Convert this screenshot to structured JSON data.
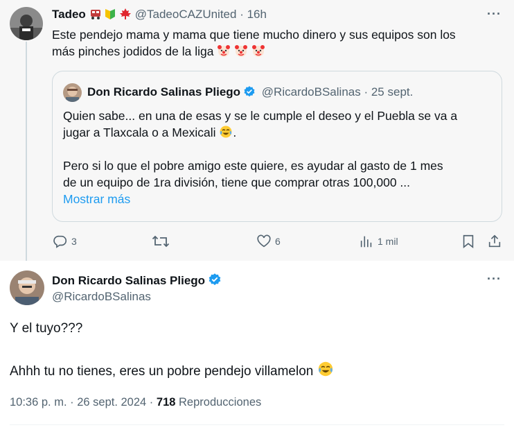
{
  "parent_tweet": {
    "name": "Tadeo",
    "handle": "@TadeoCAZUnited",
    "time": "· 16h",
    "text_line1": "Este pendejo mama y mama que tiene mucho dinero y sus equipos son los",
    "text_line2": "más pinches jodidos de la liga",
    "text_emojis": [
      "clown-face",
      "clown-face",
      "clown-face"
    ],
    "name_emojis": [
      "train",
      "beginner-shield",
      "maple-leaf"
    ],
    "quote": {
      "name": "Don Ricardo Salinas Pliego",
      "handle": "@RicardoBSalinas",
      "time": "· 25 sept.",
      "line1": "Quien sabe... en una de esas y se le cumple el deseo y el Puebla se va a",
      "line2": "jugar a Tlaxcala o a Mexicali",
      "line2_end": ".",
      "line3": "Pero si lo que el pobre amigo este quiere, es ayudar al gasto de 1 mes",
      "line4": "de un equipo de 1ra división, tiene que comprar otras 100,000 ...",
      "show_more": "Mostrar más"
    },
    "actions": {
      "replies": "3",
      "likes": "6",
      "views": "1 mil"
    }
  },
  "main_tweet": {
    "name": "Don Ricardo Salinas Pliego",
    "handle": "@RicardoBSalinas",
    "line1": "Y el tuyo???",
    "line2": "Ahhh tu no tienes, eres un pobre pendejo villamelon",
    "time": "10:36 p. m. · 26 sept. 2024 ·",
    "views_count": "718",
    "views_label": "Reproducciones"
  },
  "colors": {
    "accent": "#1d9bf0",
    "text": "#0f1419",
    "secondary": "#536471",
    "border": "#cfd9de"
  },
  "icons": [
    "reply-icon",
    "retweet-icon",
    "like-icon",
    "views-icon",
    "bookmark-icon",
    "share-icon",
    "more-icon",
    "verified-badge-icon"
  ]
}
